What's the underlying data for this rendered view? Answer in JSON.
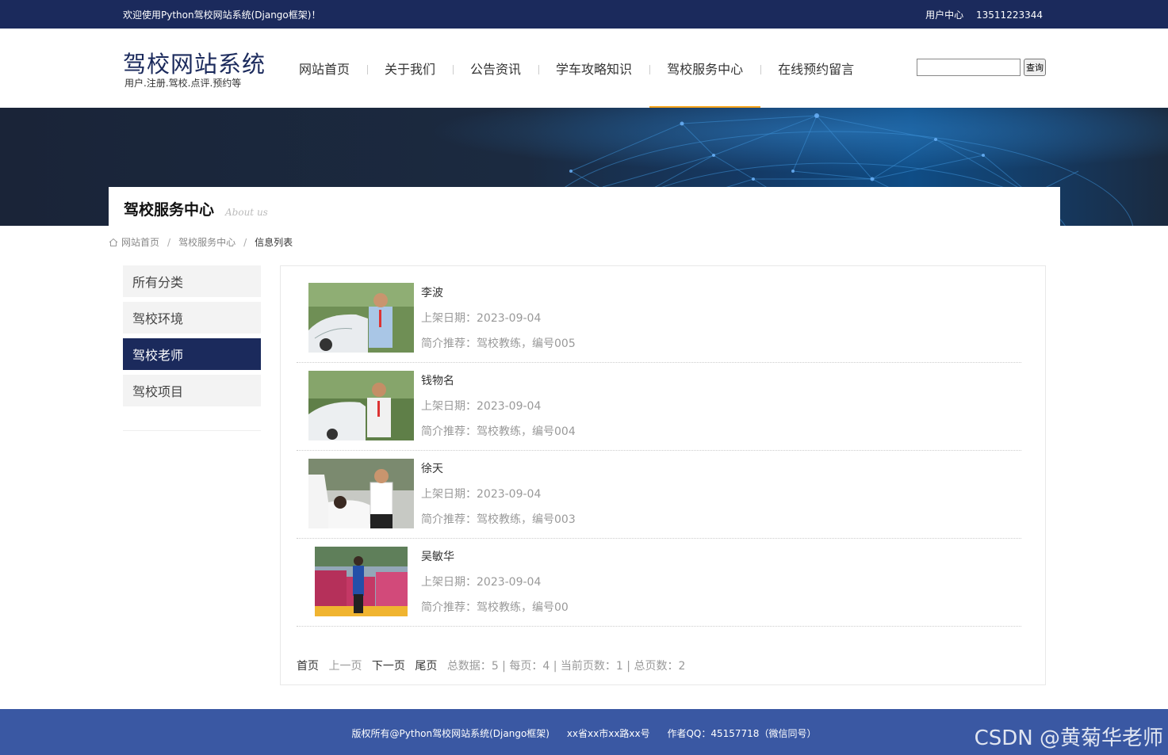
{
  "topbar": {
    "welcome": "欢迎使用Python驾校网站系统(Django框架)！",
    "user_center": "用户中心",
    "phone": "13511223344"
  },
  "header": {
    "title": "驾校网站系统",
    "subtitle": "用户.注册.驾校.点评.预约等",
    "nav": [
      "网站首页",
      "关于我们",
      "公告资讯",
      "学车攻略知识",
      "驾校服务中心",
      "在线预约留言"
    ],
    "active_nav_index": 4,
    "search_value": "",
    "search_button": "查询"
  },
  "banner": {
    "title": "驾校服务中心",
    "subtitle": "About us"
  },
  "breadcrumb": {
    "home": "网站首页",
    "section": "驾校服务中心",
    "current": "信息列表"
  },
  "sidebar": {
    "items": [
      "所有分类",
      "驾校环境",
      "驾校老师",
      "驾校项目"
    ],
    "active_index": 2
  },
  "list": {
    "date_label": "上架日期：",
    "intro_label": "简介推荐：",
    "items": [
      {
        "name": "李波",
        "date": "2023-09-04",
        "intro": "驾校教练，编号005"
      },
      {
        "name": "钱物名",
        "date": "2023-09-04",
        "intro": "驾校教练，编号004"
      },
      {
        "name": "徐天",
        "date": "2023-09-04",
        "intro": "驾校教练，编号003"
      },
      {
        "name": "吴敏华",
        "date": "2023-09-04",
        "intro": "驾校教练，编号00"
      }
    ]
  },
  "pager": {
    "first": "首页",
    "prev": "上一页",
    "next": "下一页",
    "last": "尾页",
    "total_label": "总数据：",
    "total": "5",
    "per_page_label": "每页：",
    "per_page": "4",
    "current_label": "当前页数：",
    "current": "1",
    "pages_label": "总页数：",
    "pages": "2"
  },
  "footer": {
    "copyright": "版权所有@Python驾校网站系统(Django框架)",
    "address": "xx省xx市xx路xx号",
    "qq": "作者QQ：45157718（微信同号）",
    "watermark": "CSDN @黄菊华老师"
  },
  "colors": {
    "primary": "#1b2a5c",
    "accent": "#f5a31a",
    "footer": "#3a58a3"
  }
}
